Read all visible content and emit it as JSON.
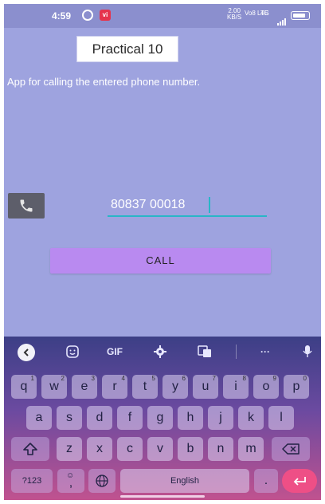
{
  "status_bar": {
    "time": "4:59",
    "whatsapp_icon": "whatsapp-icon",
    "vi_icon": "vi-icon",
    "vi_label": "vi",
    "speed_value": "2.00",
    "speed_unit": "KB/S",
    "network": "Vo8 LTE",
    "signal_label": "4G",
    "battery_icon": "battery-icon"
  },
  "app": {
    "title": "Practical 10",
    "description": "App for calling the entered phone number.",
    "call_icon": "phone-icon",
    "phone_input": {
      "value": "80837 00018"
    },
    "call_button_label": "CALL"
  },
  "keyboard": {
    "toolbar": {
      "back_icon": "chevron-left-icon",
      "sticker_icon": "sticker-icon",
      "gif_label": "GIF",
      "settings_icon": "gear-icon",
      "translate_icon": "translate-icon",
      "more_label": "···",
      "mic_icon": "mic-icon"
    },
    "row1": [
      {
        "key": "q",
        "num": "1"
      },
      {
        "key": "w",
        "num": "2"
      },
      {
        "key": "e",
        "num": "3"
      },
      {
        "key": "r",
        "num": "4"
      },
      {
        "key": "t",
        "num": "5"
      },
      {
        "key": "y",
        "num": "6"
      },
      {
        "key": "u",
        "num": "7"
      },
      {
        "key": "i",
        "num": "8"
      },
      {
        "key": "o",
        "num": "9"
      },
      {
        "key": "p",
        "num": "0"
      }
    ],
    "row2": [
      "a",
      "s",
      "d",
      "f",
      "g",
      "h",
      "j",
      "k",
      "l"
    ],
    "row3": [
      "z",
      "x",
      "c",
      "v",
      "b",
      "n",
      "m"
    ],
    "shift_icon": "shift-icon",
    "backspace_icon": "backspace-icon",
    "symbols_label": "?123",
    "emoji_comma_label": ",",
    "globe_icon": "globe-icon",
    "space_label": "English",
    "period_label": ".",
    "enter_icon": "enter-icon"
  },
  "colors": {
    "app_background": "#9ea3df",
    "call_button": "#b98af0",
    "input_underline": "#29b6c7",
    "enter_key": "#ee4f86"
  }
}
